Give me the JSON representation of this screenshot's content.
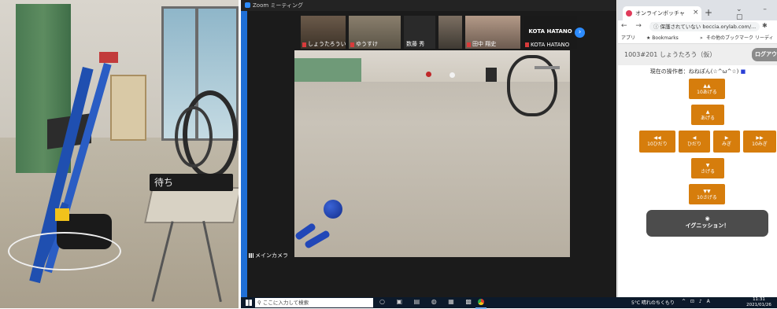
{
  "photo": {
    "sign_text": "待ち"
  },
  "zoom": {
    "window_title": "Zoom ミーティング",
    "participants": [
      {
        "name": "しょうたろういまいとお"
      },
      {
        "name": "ゆうすけ"
      },
      {
        "name": "数藤 秀"
      },
      {
        "name": ""
      },
      {
        "name": "田中 翔史"
      },
      {
        "name": "KOTA HATANO",
        "caption": "KOTA HATANO"
      }
    ],
    "camera_label": "メインカメラ"
  },
  "browser": {
    "tab_title": "オンラインボッチャ",
    "tab_close": "×",
    "new_tab": "+",
    "window_controls": "⌄ – ▢",
    "nav_buttons": "← → C ⌂",
    "url_secure": "保護されていない",
    "url": "boccia.orylab.com/...",
    "bookmarks": {
      "apps": "アプリ",
      "bookmarks": "★ Bookmarks",
      "more": "»",
      "other": "その他のブックマーク",
      "reading": "リーディ"
    },
    "page": {
      "room": "1003#201 しょうたろう（仮）",
      "logout": "ログアウト",
      "operator": "現在の操作者：ねねぽん(☆^ω^☆)",
      "buttons": {
        "up10": {
          "arrow": "▲▲",
          "label": "10あげる"
        },
        "up": {
          "arrow": "▲",
          "label": "あげる"
        },
        "left10": {
          "arrow": "◀◀",
          "label": "10ひだり"
        },
        "left": {
          "arrow": "◀",
          "label": "ひだり"
        },
        "right": {
          "arrow": "▶",
          "label": "みぎ"
        },
        "right10": {
          "arrow": "▶▶",
          "label": "10みぎ"
        },
        "down": {
          "arrow": "▼",
          "label": "さげる"
        },
        "down10": {
          "arrow": "▼▼",
          "label": "10さげる"
        },
        "ignite": {
          "icon": "◉",
          "label": "イグニッション！"
        }
      }
    }
  },
  "taskbar": {
    "search_placeholder": "ここに入力して検索",
    "weather": "5°C 晴れのちくもり",
    "tray": "^ ⊡ ♪ A",
    "time": "11:31",
    "date": "2021/01/26"
  },
  "colors": {
    "control_orange": "#d67d0c",
    "ignite_dark": "#4c4c4c",
    "zoom_blue": "#2d8cff"
  }
}
